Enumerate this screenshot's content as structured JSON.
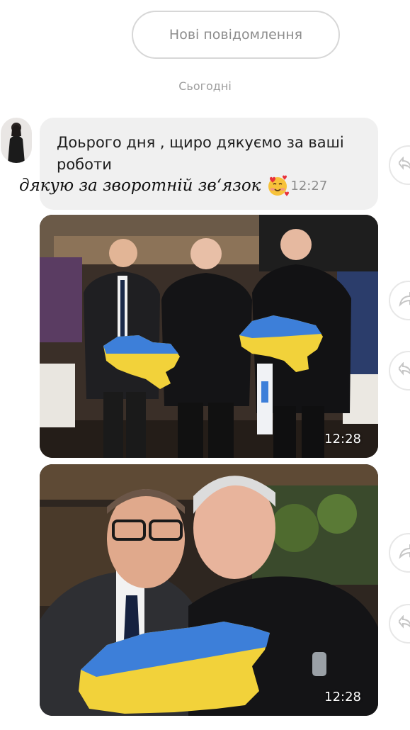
{
  "header": {
    "new_messages_label": "Нові повідомлення"
  },
  "date_separator": "Сьогодні",
  "message": {
    "text": "Доьрого дня , щиро дякуємо за ваші роботи",
    "overlay_text": "дякую за зворотній зв‘язок",
    "emoji": "smiling-face-with-hearts-icon",
    "time": "12:27"
  },
  "photos": [
    {
      "time": "12:28"
    },
    {
      "time": "12:28"
    }
  ],
  "colors": {
    "bubble": "#f0f0f0",
    "ukraine_blue": "#3d7fd9",
    "ukraine_yellow": "#f2d23a"
  }
}
